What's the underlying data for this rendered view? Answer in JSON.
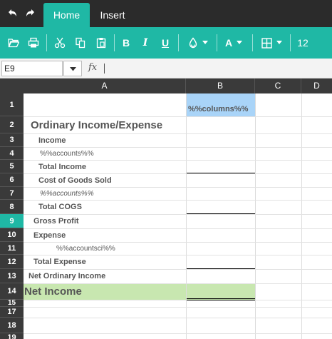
{
  "menubar": {
    "undo_icon": "undo-icon",
    "redo_icon": "redo-icon",
    "tabs": [
      {
        "label": "Home",
        "active": true
      },
      {
        "label": "Insert",
        "active": false
      }
    ]
  },
  "toolbar": {
    "icons": [
      "open-folder-icon",
      "print-icon",
      "cut-icon",
      "copy-icon",
      "paste-icon",
      "bold-icon",
      "italic-icon",
      "underline-icon",
      "fill-color-icon",
      "font-color-icon",
      "borders-icon"
    ],
    "bold": "B",
    "italic": "I",
    "underline": "U",
    "font_color": "A",
    "font_size": "12"
  },
  "formula_bar": {
    "name_box": "E9",
    "fx_label": "fx",
    "formula": ""
  },
  "columns": [
    "A",
    "B",
    "C",
    "D"
  ],
  "rows": [
    "1",
    "2",
    "3",
    "4",
    "5",
    "6",
    "7",
    "8",
    "9",
    "10",
    "11",
    "12",
    "13",
    "14",
    "15",
    "17",
    "18",
    "19"
  ],
  "selected_row": "9",
  "cells": {
    "b1": "%%columns%%",
    "a2": "Ordinary Income/Expense",
    "a3": "Income",
    "a4": "%%accounts%%",
    "a5": "Total Income",
    "a6": "Cost of Goods Sold",
    "a7": "%%accounts%%",
    "a8": "Total COGS",
    "a9": "Gross Profit",
    "a10": "Expense",
    "a11": "%%accountsci%%",
    "a12": "Total Expense",
    "a13": "Net Ordinary Income",
    "a14": "Net Income"
  },
  "colors": {
    "accent": "#1fb8a5",
    "header_dark": "#3a3a3a",
    "menubar": "#2b2b2b",
    "columns_cell": "#a9d4f8",
    "net_income_row": "#c8e7b0"
  }
}
